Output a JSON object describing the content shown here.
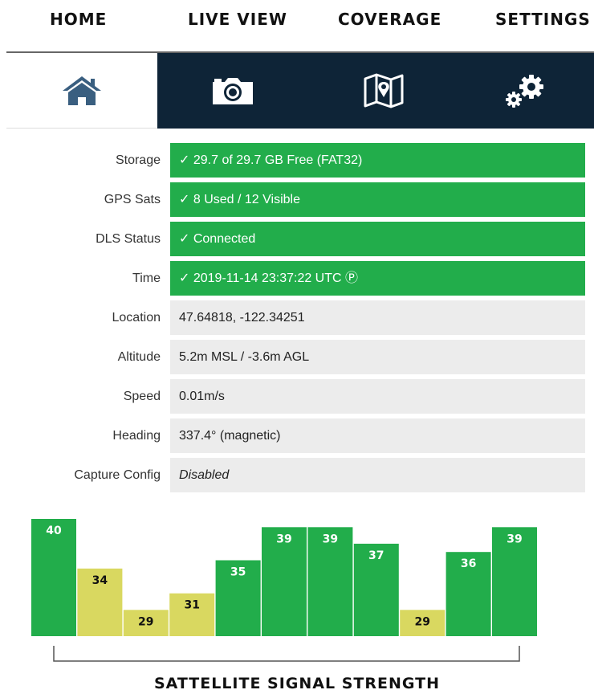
{
  "nav": {
    "tabs": [
      {
        "label": "HOME",
        "icon": "home-icon"
      },
      {
        "label": "LIVE VIEW",
        "icon": "camera-icon"
      },
      {
        "label": "COVERAGE",
        "icon": "map-icon"
      },
      {
        "label": "SETTINGS",
        "icon": "gears-icon"
      }
    ],
    "active_tab": "HOME"
  },
  "status": {
    "storage": {
      "label": "Storage",
      "value": "✓ 29.7 of 29.7 GB Free (FAT32)"
    },
    "gps": {
      "label": "GPS Sats",
      "value": "✓ 8 Used / 12 Visible"
    },
    "dls": {
      "label": "DLS Status",
      "value": "✓ Connected"
    },
    "time": {
      "label": "Time",
      "value": "✓ 2019-11-14 23:37:22 UTC Ⓟ"
    },
    "location": {
      "label": "Location",
      "value": "47.64818, -122.34251"
    },
    "altitude": {
      "label": "Altitude",
      "value": "5.2m MSL / -3.6m AGL"
    },
    "speed": {
      "label": "Speed",
      "value": "0.01m/s"
    },
    "heading": {
      "label": "Heading",
      "value": "337.4° (magnetic)"
    },
    "capture": {
      "label": "Capture Config",
      "value": "Disabled"
    }
  },
  "colors": {
    "ok": "#22ad4b",
    "neutral": "#ececec",
    "nav_dark": "#0e2437",
    "signal_strong": "#22ad4b",
    "signal_weak": "#d9d860"
  },
  "chart_data": {
    "type": "bar",
    "title": "SATTELLITE SIGNAL STRENGTH",
    "values": [
      40,
      34,
      29,
      31,
      35,
      39,
      39,
      37,
      29,
      36,
      39
    ],
    "strength_class": [
      "strong",
      "weak",
      "weak",
      "weak",
      "strong",
      "strong",
      "strong",
      "strong",
      "weak",
      "strong",
      "strong"
    ],
    "ylim": [
      0,
      40
    ]
  }
}
